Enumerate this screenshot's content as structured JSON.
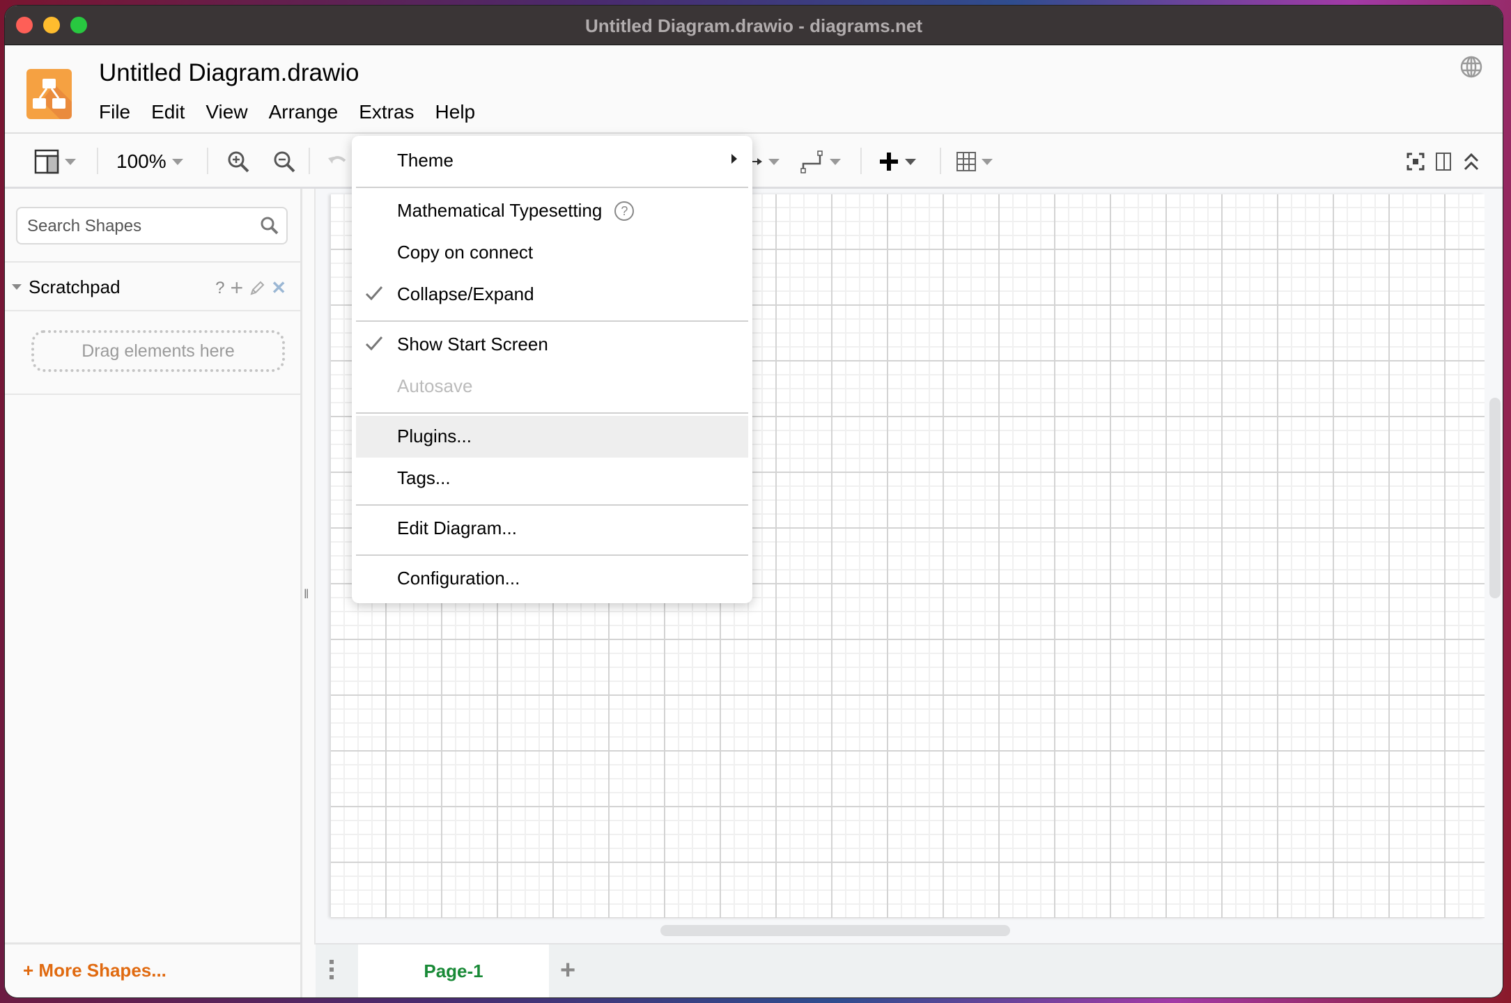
{
  "window": {
    "title": "Untitled Diagram.drawio - diagrams.net"
  },
  "header": {
    "doc_title": "Untitled Diagram.drawio",
    "menus": [
      "File",
      "Edit",
      "View",
      "Arrange",
      "Extras",
      "Help"
    ],
    "globe_icon": "globe-icon"
  },
  "toolbar": {
    "zoom": "100%",
    "icons": [
      "format-panel-icon",
      "zoom-in-icon",
      "zoom-out-icon",
      "undo-icon",
      "connection-arrow-icon",
      "waypoint-icon",
      "insert-plus-icon",
      "table-icon",
      "fullscreen-icon",
      "toggle-panel-icon",
      "collapse-toolbar-icon"
    ]
  },
  "sidebar": {
    "search_placeholder": "Search Shapes",
    "scratchpad_label": "Scratchpad",
    "scratchpad_help": "?",
    "scratchpad_add": "+",
    "scratchpad_close": "✕",
    "dropzone_text": "Drag elements here",
    "more_shapes": "+ More Shapes..."
  },
  "pages": {
    "tabs": [
      {
        "label": "Page-1",
        "active": true
      }
    ],
    "add": "+"
  },
  "extras_menu": {
    "items": [
      {
        "label": "Theme",
        "submenu": true
      },
      {
        "label": "Mathematical Typesetting",
        "help": true
      },
      {
        "label": "Copy on connect"
      },
      {
        "label": "Collapse/Expand",
        "checked": true
      },
      {
        "label": "Show Start Screen",
        "checked": true
      },
      {
        "label": "Autosave",
        "disabled": true
      },
      {
        "label": "Plugins...",
        "highlighted": true
      },
      {
        "label": "Tags..."
      },
      {
        "label": "Edit Diagram..."
      },
      {
        "label": "Configuration..."
      }
    ],
    "help_glyph": "?"
  },
  "colors": {
    "accent_orange": "#e06a10",
    "page_tab_green": "#198a37",
    "logo_orange": "#f08705"
  }
}
